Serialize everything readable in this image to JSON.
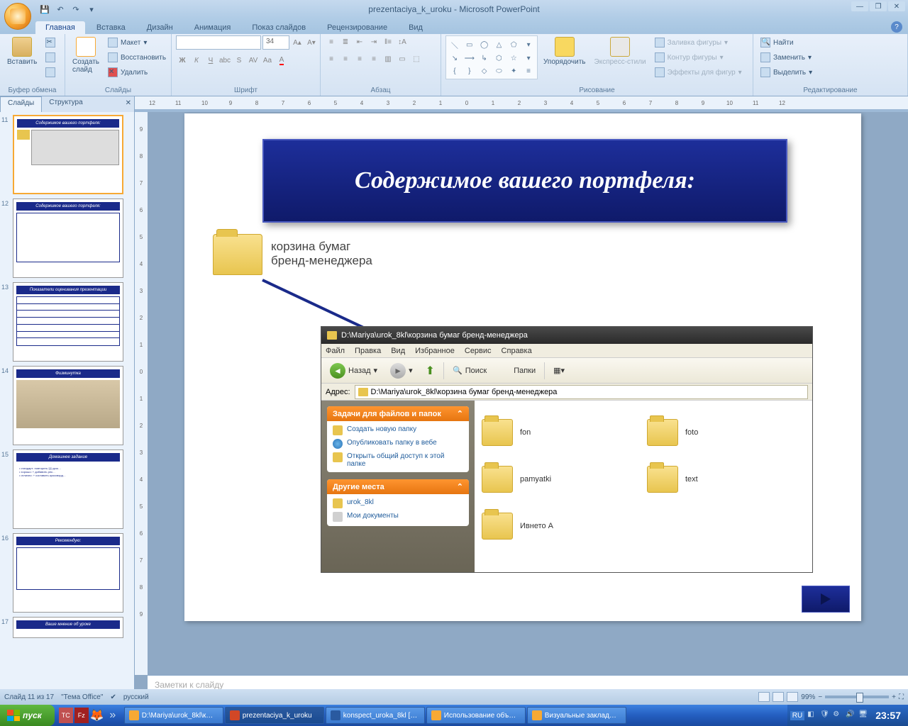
{
  "app": {
    "title_doc": "prezentaciya_k_uroku",
    "title_app": "Microsoft PowerPoint"
  },
  "ribbon": {
    "tabs": [
      "Главная",
      "Вставка",
      "Дизайн",
      "Анимация",
      "Показ слайдов",
      "Рецензирование",
      "Вид"
    ],
    "active_tab": 0,
    "groups": {
      "clipboard": {
        "label": "Буфер обмена",
        "paste": "Вставить"
      },
      "slides": {
        "label": "Слайды",
        "new_slide": "Создать\nслайд",
        "layout": "Макет",
        "reset": "Восстановить",
        "delete": "Удалить"
      },
      "font": {
        "label": "Шрифт",
        "size": "34"
      },
      "paragraph": {
        "label": "Абзац"
      },
      "drawing": {
        "label": "Рисование",
        "arrange": "Упорядочить",
        "quick_styles": "Экспресс-стили",
        "fill": "Заливка фигуры",
        "outline": "Контур фигуры",
        "effects": "Эффекты для фигур"
      },
      "editing": {
        "label": "Редактирование",
        "find": "Найти",
        "replace": "Заменить",
        "select": "Выделить"
      }
    }
  },
  "panel": {
    "slides_tab": "Слайды",
    "outline_tab": "Структура"
  },
  "thumbnails": [
    {
      "num": "11",
      "title": "Содержимое вашего портфеля:"
    },
    {
      "num": "12",
      "title": "Содержимое вашего портфеля:"
    },
    {
      "num": "13",
      "title": "Показатели оценивания презентации"
    },
    {
      "num": "14",
      "title": "Физминутка"
    },
    {
      "num": "15",
      "title": "Домашнее задание"
    },
    {
      "num": "16",
      "title": "Рекомендую:"
    },
    {
      "num": "17",
      "title": "Ваше мнение об уроке"
    }
  ],
  "slide": {
    "title": "Содержимое вашего портфеля:",
    "folder_label_l1": "корзина бумаг",
    "folder_label_l2": "бренд-менеджера",
    "explorer": {
      "window_title": "D:\\Mariya\\urok_8kl\\корзина бумаг бренд-менеджера",
      "menus": [
        "Файл",
        "Правка",
        "Вид",
        "Избранное",
        "Сервис",
        "Справка"
      ],
      "back": "Назад",
      "search": "Поиск",
      "folders_btn": "Папки",
      "address_label": "Адрес:",
      "address_value": "D:\\Mariya\\urok_8kl\\корзина бумаг бренд-менеджера",
      "tasks_header": "Задачи для файлов и папок",
      "tasks": [
        "Создать новую папку",
        "Опубликовать папку в вебе",
        "Открыть общий доступ к этой папке"
      ],
      "places_header": "Другие места",
      "places": [
        "urok_8kl",
        "Мои документы"
      ],
      "files": [
        "fon",
        "foto",
        "pamyatki",
        "text",
        "Ивнето А"
      ]
    }
  },
  "notes_placeholder": "Заметки к слайду",
  "statusbar": {
    "slide_info": "Слайд 11 из 17",
    "theme": "\"Тема Office\"",
    "lang": "русский",
    "zoom": "99%"
  },
  "taskbar": {
    "start": "пуск",
    "tasks": [
      "D:\\Mariya\\urok_8kl\\к…",
      "prezentaciya_k_uroku",
      "konspect_uroka_8kl […",
      "Использование объ…",
      "Визуальные заклад…"
    ],
    "lang": "RU",
    "time": "23:57"
  }
}
